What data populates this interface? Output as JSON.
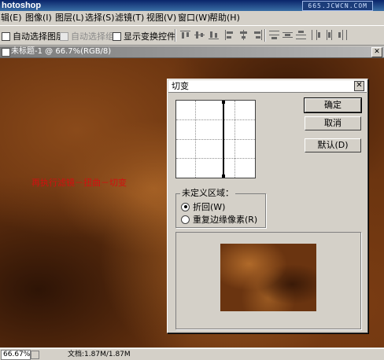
{
  "app": {
    "title": "hotoshop",
    "watermark": "665.JCWCN.COM"
  },
  "menubar": {
    "items": [
      "辑(E)",
      "图像(I)",
      "图层(L)",
      "选择(S)",
      "滤镜(T)",
      "视图(V)",
      "窗口(W)",
      "帮助(H)"
    ]
  },
  "options": {
    "auto_select_layer": "自动选择图层",
    "auto_select_group": "自动选择组",
    "show_transform": "显示变换控件"
  },
  "document": {
    "title": "未标题-1 @ 66.7%(RGB/8)",
    "annotation": "再执行滤镜－扭曲－切变",
    "zoom": "66.67%",
    "doc_info": "文档:1.87M/1.87M"
  },
  "dialog": {
    "title": "切变",
    "ok": "确定",
    "cancel": "取消",
    "default": "默认(D)",
    "undefined_area_label": "未定义区域：",
    "wrap_around": "折回(W)",
    "repeat_edge": "重复边缘像素(R)",
    "selected_option": "wrap_around"
  },
  "colors": {
    "title_bar": "#0a246a",
    "annotation": "#d21010",
    "canvas": "#6a3410"
  },
  "icons": [
    "close-icon",
    "document-icon",
    "checkbox-icon",
    "radio-icon",
    "align-icon",
    "distribute-icon"
  ]
}
